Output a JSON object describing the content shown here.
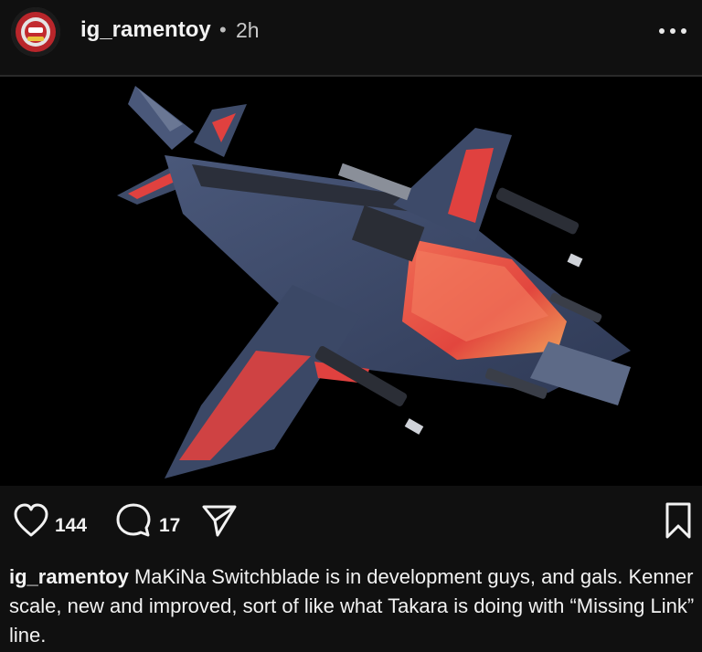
{
  "post": {
    "username": "ig_ramentoy",
    "separator": "•",
    "time": "2h",
    "likes": "144",
    "comments": "17",
    "caption_text": "MaKiNa Switchblade is in development guys, and gals. Kenner scale, new and improved, sort of like what Takara is doing with “Missing Link” line."
  },
  "icons": {
    "avatar": "ramen-toy-logo",
    "more": "more-options-icon",
    "like": "heart-icon",
    "comment": "comment-icon",
    "share": "send-icon",
    "save": "bookmark-icon"
  },
  "colors": {
    "background": "#101010",
    "text": "#f5f5f5",
    "secondary_text": "#c8c8c8",
    "media_bg": "#000000",
    "jet_blue": "#3c4a6a",
    "jet_red": "#e0413f"
  }
}
